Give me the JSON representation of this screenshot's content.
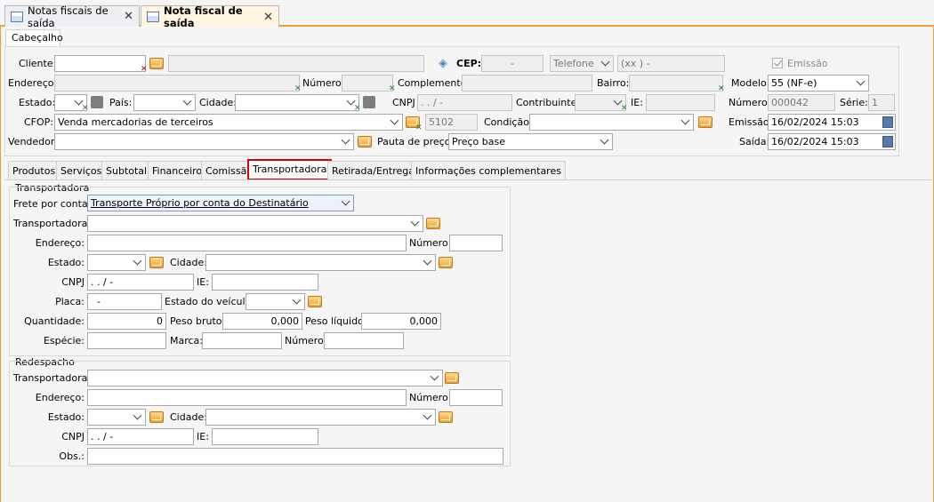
{
  "tabs": [
    {
      "label": "Notas fiscais de saída",
      "active": false
    },
    {
      "label": "Nota fiscal de saída",
      "active": true
    }
  ],
  "header": {
    "section_title": "Cabeçalho",
    "cliente_label": "Cliente:",
    "cep_label": "CEP:",
    "cep_value": "-",
    "telefone_select": "Telefone",
    "telefone_value": "(xx )  -",
    "emissao_check_label": "Emissão",
    "endereco_label": "Endereço:",
    "numero_label": "Número:",
    "complemento_label": "Complemento:",
    "bairro_label": "Bairro:",
    "modelo_label": "Modelo:",
    "modelo_value": "55 (NF-e)",
    "estado_label": "Estado:",
    "pais_label": "País:",
    "cidade_label": "Cidade:",
    "cnpj_label": "CNPJ",
    "cnpj_value": ".  .  /  -",
    "contribuinte_label": "Contribuinte:",
    "ie_label": "IE:",
    "numero2_label": "Número:",
    "numero2_value": "000042",
    "serie_label": "Série:",
    "serie_value": "1",
    "cfop_label": "CFOP:",
    "cfop_value": "Venda mercadorias de terceiros",
    "cfop_code": "5102",
    "condicao_label": "Condição:",
    "emissao_label": "Emissão:",
    "emissao_value": "16/02/2024 15:03",
    "vendedor_label": "Vendedor:",
    "pauta_label": "Pauta de preço:",
    "pauta_value": "Preço base",
    "saida_label": "Saída:",
    "saida_value": "16/02/2024 15:03"
  },
  "subtabs": [
    "Produtos",
    "Serviços",
    "Subtotal",
    "Financeiro",
    "Comissão",
    "Transportadora",
    "Retirada/Entrega",
    "Informações complementares"
  ],
  "transportadora": {
    "title": "Transportadora",
    "frete_label": "Frete por conta:",
    "frete_value": "Transporte Próprio por conta do Destinatário",
    "transp_label": "Transportadora:",
    "endereco_label": "Endereço:",
    "numero_label": "Número:",
    "estado_label": "Estado:",
    "cidade_label": "Cidade:",
    "cnpj_label": "CNPJ",
    "cnpj_value": ".  .  /  -",
    "ie_label": "IE:",
    "placa_label": "Placa:",
    "placa_value": "-",
    "estado_veiculo_label": "Estado do veículo:",
    "quantidade_label": "Quantidade:",
    "quantidade_value": "0",
    "peso_bruto_label": "Peso bruto:",
    "peso_bruto_value": "0,000",
    "peso_liquido_label": "Peso líquido:",
    "peso_liquido_value": "0,000",
    "especie_label": "Espécie:",
    "marca_label": "Marca:",
    "numero2_label": "Número:"
  },
  "redespacho": {
    "title": "Redespacho",
    "transp_label": "Transportadora:",
    "endereco_label": "Endereço:",
    "numero_label": "Número:",
    "estado_label": "Estado:",
    "cidade_label": "Cidade:",
    "cnpj_label": "CNPJ",
    "cnpj_value": ".  .  /  -",
    "ie_label": "IE:",
    "obs_label": "Obs.:"
  },
  "colors": {
    "accent": "#f0a030",
    "highlight": "#dc0000"
  }
}
